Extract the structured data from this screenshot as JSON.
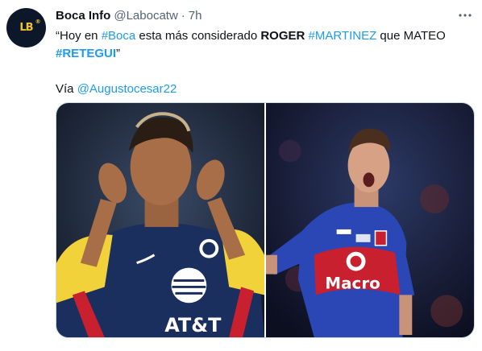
{
  "tweet": {
    "display_name": "Boca Info",
    "handle": "@Labocatw",
    "separator": "·",
    "time": "7h",
    "avatar_letters": "LB",
    "avatar_sup": "®",
    "text": {
      "line1": {
        "t1": "“Hoy en ",
        "t2": "#Boca",
        "t3": " esta más considerado ",
        "t4": "ROGER",
        "t5": " ",
        "t6": "#MARTINEZ",
        "t7": " que MATEO"
      },
      "line2": {
        "t1": "#RETEGUI",
        "t2": "”"
      },
      "via": {
        "label": "Vía ",
        "mention": "@Augustocesar22"
      }
    },
    "media": {
      "left_photo": {
        "icon": "soccer-player-photo",
        "jersey_sponsor": "AT&T"
      },
      "right_photo": {
        "icon": "soccer-player-photo",
        "jersey_sponsor": "Macro"
      }
    }
  },
  "colors": {
    "link": "#1d9bf0",
    "secondary_text": "#536471",
    "primary_text": "#0f1419",
    "border": "#cfd9de"
  }
}
